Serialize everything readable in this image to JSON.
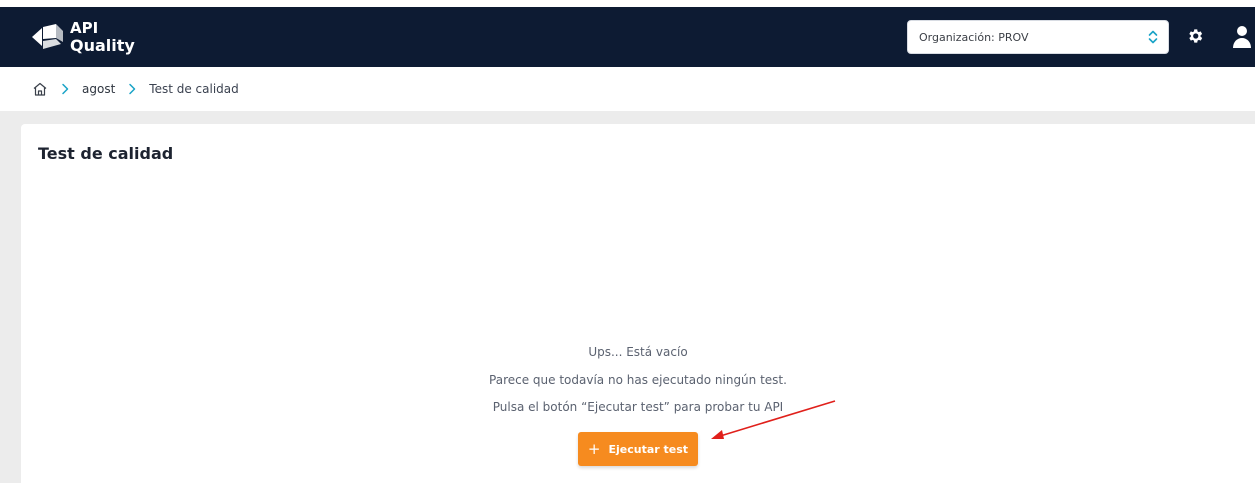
{
  "app": {
    "logo_line1": "API",
    "logo_line2": "Quality",
    "brand_color": "#0d1b33",
    "accent_color": "#f68b1f"
  },
  "header": {
    "organization_select": "Organización: PROV",
    "settings_icon": "gear-icon",
    "user_icon": "user-icon"
  },
  "breadcrumb": {
    "home_icon": "home-icon",
    "items": [
      "agost",
      "Test de calidad"
    ]
  },
  "main": {
    "title": "Test de calidad",
    "empty_title": "Ups... Está vacío",
    "empty_line1": "Parece que todavía no has ejecutado ningún test.",
    "empty_line2": "Pulsa el botón “Ejecutar test” para probar tu API",
    "run_button": "Ejecutar test",
    "run_button_icon": "plus-icon",
    "annotation_color": "#e0201b"
  }
}
